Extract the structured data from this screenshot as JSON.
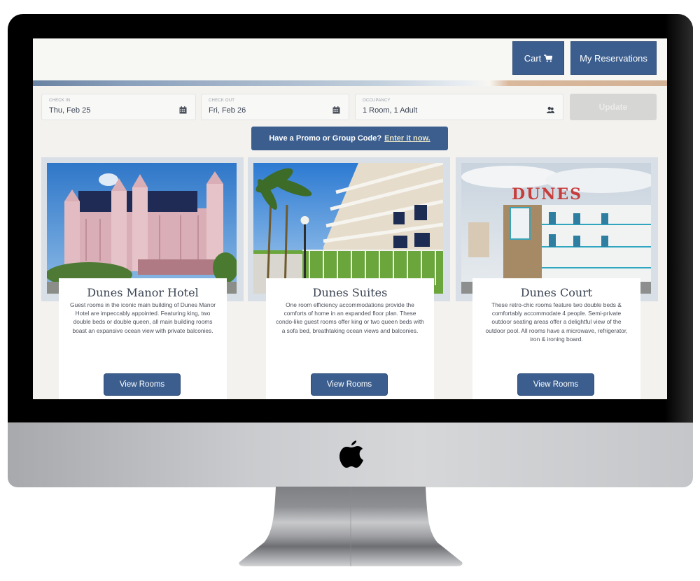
{
  "header": {
    "cart_label": "Cart",
    "cart_icon": "shopping-cart-icon",
    "reservations_label": "My Reservations"
  },
  "search": {
    "check_in": {
      "label": "CHECK IN",
      "value": "Thu, Feb 25",
      "icon": "calendar-icon"
    },
    "check_out": {
      "label": "CHECK OUT",
      "value": "Fri, Feb 26",
      "icon": "calendar-icon"
    },
    "occupancy": {
      "label": "OCCUPANCY",
      "value": "1 Room, 1 Adult",
      "icon": "users-icon"
    },
    "update_label": "Update"
  },
  "promo": {
    "text": "Have a Promo or Group Code?",
    "link_label": "Enter it now."
  },
  "properties": [
    {
      "name": "Dunes Manor Hotel",
      "description": "Guest rooms in the iconic main building of Dunes Manor Hotel are impeccably appointed. Featuring king, two double beds or double queen, all main building rooms boast an expansive ocean view with private balconies.",
      "button_label": "View Rooms"
    },
    {
      "name": "Dunes Suites",
      "description": "One room efficiency accommodations provide the comforts of home in an expanded floor plan. These condo-like guest rooms offer king or two queen beds with a sofa bed, breathtaking ocean views and balconies.",
      "button_label": "View Rooms"
    },
    {
      "name": "Dunes Court",
      "description": "These retro-chic rooms feature two double beds & comfortably accommodate 4 people. Semi-private outdoor seating areas offer a delightful view of the outdoor pool. All rooms have a microwave, refrigerator, iron & ironing board.",
      "button_label": "View Rooms",
      "sign_text": "DUNES"
    }
  ],
  "colors": {
    "brand_blue": "#3b5e8f",
    "disabled_gray": "#d6d6d5",
    "link_cream": "#e9e6c8"
  }
}
